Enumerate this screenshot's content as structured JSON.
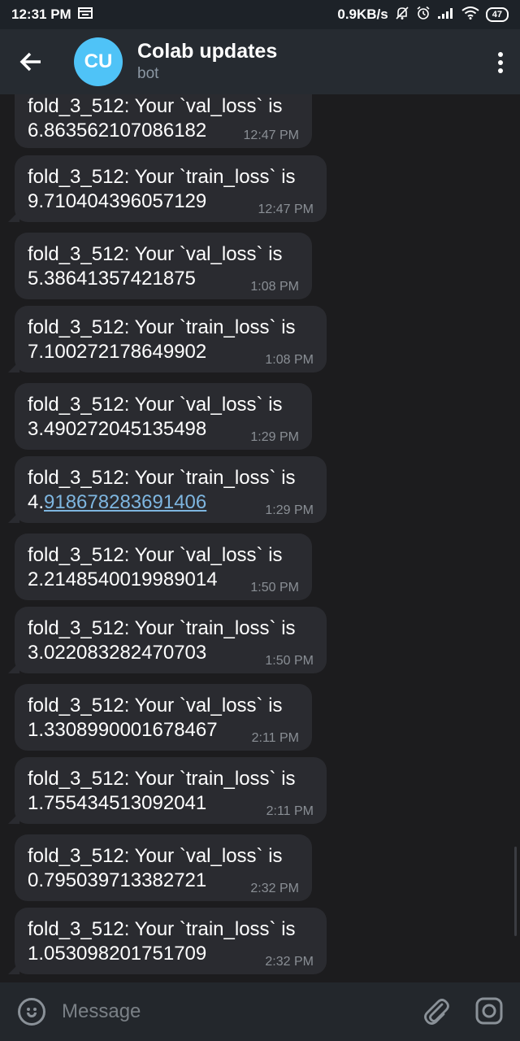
{
  "status_bar": {
    "time": "12:31 PM",
    "net_speed": "0.9KB/s",
    "battery": "47"
  },
  "header": {
    "avatar_initials": "CU",
    "title": "Colab updates",
    "subtitle": "bot"
  },
  "messages": [
    {
      "line1": "fold_3_512: Your `val_loss` is",
      "line2": "6.863562107086182",
      "time": "12:47 PM"
    },
    {
      "line1": "fold_3_512: Your `train_loss` is",
      "line2": "9.710404396057129",
      "time": "12:47 PM"
    },
    {
      "line1": "fold_3_512: Your `val_loss` is",
      "line2": "5.38641357421875",
      "time": "1:08 PM"
    },
    {
      "line1": "fold_3_512: Your `train_loss` is",
      "line2": "7.100272178649902",
      "time": "1:08 PM"
    },
    {
      "line1": "fold_3_512: Your `val_loss` is",
      "line2": "3.490272045135498",
      "time": "1:29 PM"
    },
    {
      "line1": "fold_3_512: Your `train_loss` is",
      "line2_prefix": "4.",
      "line2_link": "918678283691406",
      "time": "1:29 PM"
    },
    {
      "line1": "fold_3_512: Your `val_loss` is",
      "line2": "2.2148540019989014",
      "time": "1:50 PM"
    },
    {
      "line1": "fold_3_512: Your `train_loss` is",
      "line2": "3.022083282470703",
      "time": "1:50 PM"
    },
    {
      "line1": "fold_3_512: Your `val_loss` is",
      "line2": "1.3308990001678467",
      "time": "2:11 PM"
    },
    {
      "line1": "fold_3_512: Your `train_loss` is",
      "line2": "1.755434513092041",
      "time": "2:11 PM"
    },
    {
      "line1": "fold_3_512: Your `val_loss` is",
      "line2": "0.795039713382721",
      "time": "2:32 PM"
    },
    {
      "line1": "fold_3_512: Your `train_loss` is",
      "line2": "1.053098201751709",
      "time": "2:32 PM"
    }
  ],
  "input": {
    "placeholder": "Message"
  }
}
